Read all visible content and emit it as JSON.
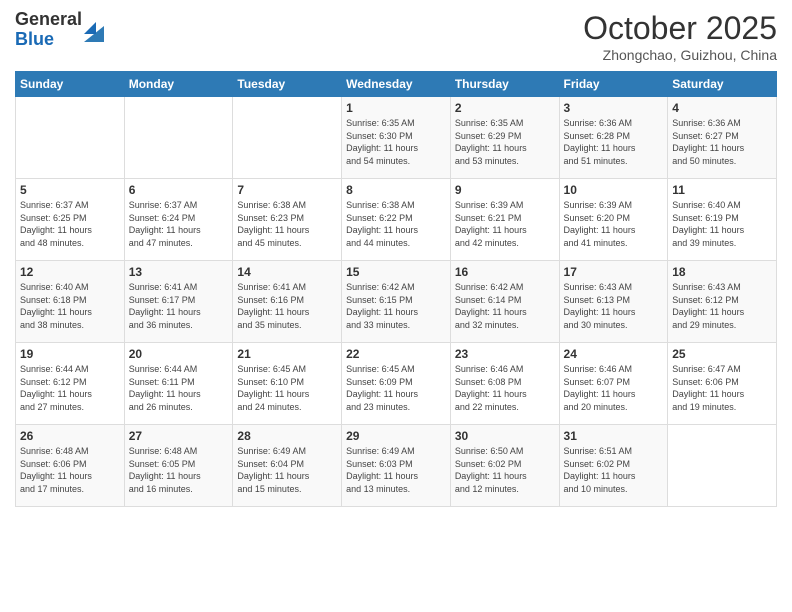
{
  "header": {
    "logo_general": "General",
    "logo_blue": "Blue",
    "month_title": "October 2025",
    "location": "Zhongchao, Guizhou, China"
  },
  "days_of_week": [
    "Sunday",
    "Monday",
    "Tuesday",
    "Wednesday",
    "Thursday",
    "Friday",
    "Saturday"
  ],
  "weeks": [
    [
      {
        "day": "",
        "info": ""
      },
      {
        "day": "",
        "info": ""
      },
      {
        "day": "",
        "info": ""
      },
      {
        "day": "1",
        "info": "Sunrise: 6:35 AM\nSunset: 6:30 PM\nDaylight: 11 hours\nand 54 minutes."
      },
      {
        "day": "2",
        "info": "Sunrise: 6:35 AM\nSunset: 6:29 PM\nDaylight: 11 hours\nand 53 minutes."
      },
      {
        "day": "3",
        "info": "Sunrise: 6:36 AM\nSunset: 6:28 PM\nDaylight: 11 hours\nand 51 minutes."
      },
      {
        "day": "4",
        "info": "Sunrise: 6:36 AM\nSunset: 6:27 PM\nDaylight: 11 hours\nand 50 minutes."
      }
    ],
    [
      {
        "day": "5",
        "info": "Sunrise: 6:37 AM\nSunset: 6:25 PM\nDaylight: 11 hours\nand 48 minutes."
      },
      {
        "day": "6",
        "info": "Sunrise: 6:37 AM\nSunset: 6:24 PM\nDaylight: 11 hours\nand 47 minutes."
      },
      {
        "day": "7",
        "info": "Sunrise: 6:38 AM\nSunset: 6:23 PM\nDaylight: 11 hours\nand 45 minutes."
      },
      {
        "day": "8",
        "info": "Sunrise: 6:38 AM\nSunset: 6:22 PM\nDaylight: 11 hours\nand 44 minutes."
      },
      {
        "day": "9",
        "info": "Sunrise: 6:39 AM\nSunset: 6:21 PM\nDaylight: 11 hours\nand 42 minutes."
      },
      {
        "day": "10",
        "info": "Sunrise: 6:39 AM\nSunset: 6:20 PM\nDaylight: 11 hours\nand 41 minutes."
      },
      {
        "day": "11",
        "info": "Sunrise: 6:40 AM\nSunset: 6:19 PM\nDaylight: 11 hours\nand 39 minutes."
      }
    ],
    [
      {
        "day": "12",
        "info": "Sunrise: 6:40 AM\nSunset: 6:18 PM\nDaylight: 11 hours\nand 38 minutes."
      },
      {
        "day": "13",
        "info": "Sunrise: 6:41 AM\nSunset: 6:17 PM\nDaylight: 11 hours\nand 36 minutes."
      },
      {
        "day": "14",
        "info": "Sunrise: 6:41 AM\nSunset: 6:16 PM\nDaylight: 11 hours\nand 35 minutes."
      },
      {
        "day": "15",
        "info": "Sunrise: 6:42 AM\nSunset: 6:15 PM\nDaylight: 11 hours\nand 33 minutes."
      },
      {
        "day": "16",
        "info": "Sunrise: 6:42 AM\nSunset: 6:14 PM\nDaylight: 11 hours\nand 32 minutes."
      },
      {
        "day": "17",
        "info": "Sunrise: 6:43 AM\nSunset: 6:13 PM\nDaylight: 11 hours\nand 30 minutes."
      },
      {
        "day": "18",
        "info": "Sunrise: 6:43 AM\nSunset: 6:12 PM\nDaylight: 11 hours\nand 29 minutes."
      }
    ],
    [
      {
        "day": "19",
        "info": "Sunrise: 6:44 AM\nSunset: 6:12 PM\nDaylight: 11 hours\nand 27 minutes."
      },
      {
        "day": "20",
        "info": "Sunrise: 6:44 AM\nSunset: 6:11 PM\nDaylight: 11 hours\nand 26 minutes."
      },
      {
        "day": "21",
        "info": "Sunrise: 6:45 AM\nSunset: 6:10 PM\nDaylight: 11 hours\nand 24 minutes."
      },
      {
        "day": "22",
        "info": "Sunrise: 6:45 AM\nSunset: 6:09 PM\nDaylight: 11 hours\nand 23 minutes."
      },
      {
        "day": "23",
        "info": "Sunrise: 6:46 AM\nSunset: 6:08 PM\nDaylight: 11 hours\nand 22 minutes."
      },
      {
        "day": "24",
        "info": "Sunrise: 6:46 AM\nSunset: 6:07 PM\nDaylight: 11 hours\nand 20 minutes."
      },
      {
        "day": "25",
        "info": "Sunrise: 6:47 AM\nSunset: 6:06 PM\nDaylight: 11 hours\nand 19 minutes."
      }
    ],
    [
      {
        "day": "26",
        "info": "Sunrise: 6:48 AM\nSunset: 6:06 PM\nDaylight: 11 hours\nand 17 minutes."
      },
      {
        "day": "27",
        "info": "Sunrise: 6:48 AM\nSunset: 6:05 PM\nDaylight: 11 hours\nand 16 minutes."
      },
      {
        "day": "28",
        "info": "Sunrise: 6:49 AM\nSunset: 6:04 PM\nDaylight: 11 hours\nand 15 minutes."
      },
      {
        "day": "29",
        "info": "Sunrise: 6:49 AM\nSunset: 6:03 PM\nDaylight: 11 hours\nand 13 minutes."
      },
      {
        "day": "30",
        "info": "Sunrise: 6:50 AM\nSunset: 6:02 PM\nDaylight: 11 hours\nand 12 minutes."
      },
      {
        "day": "31",
        "info": "Sunrise: 6:51 AM\nSunset: 6:02 PM\nDaylight: 11 hours\nand 10 minutes."
      },
      {
        "day": "",
        "info": ""
      }
    ]
  ]
}
